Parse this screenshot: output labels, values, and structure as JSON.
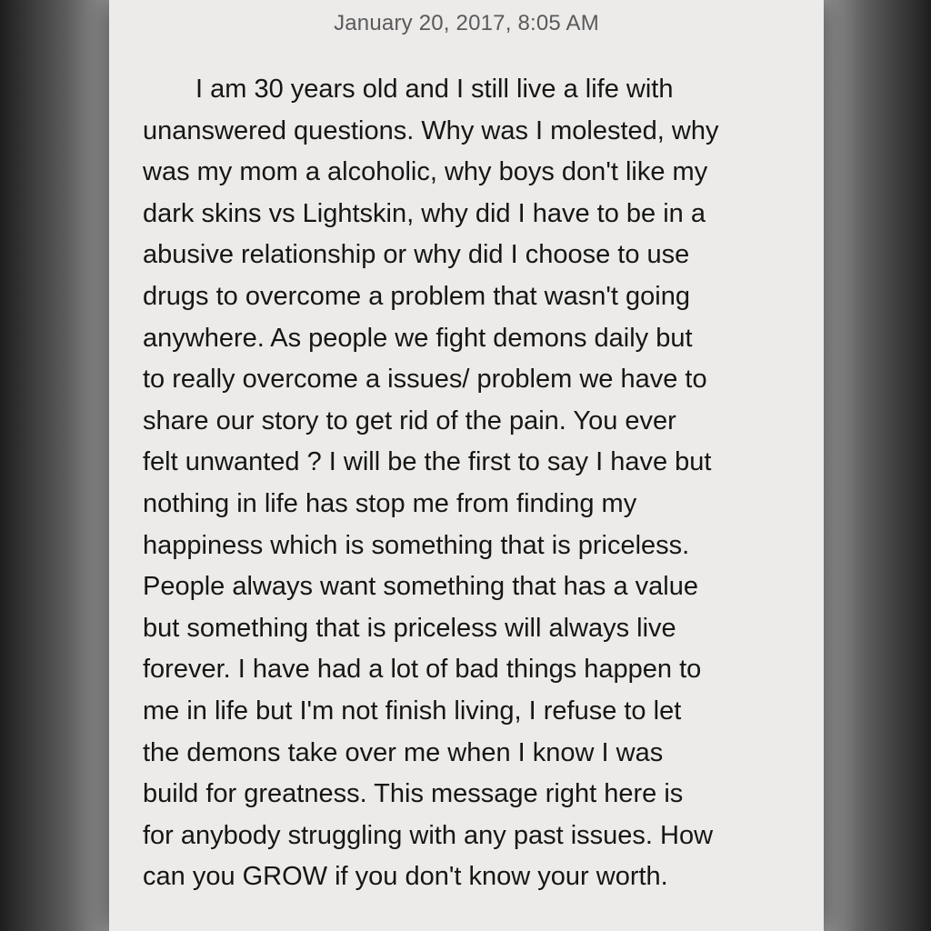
{
  "note": {
    "timestamp": "January 20, 2017, 8:05 AM",
    "body": "I am 30 years old and I still live a life with\nunanswered questions. Why was I molested, why\nwas my mom a alcoholic, why boys don't like my\ndark skins vs Lightskin, why did I have to be in a\nabusive relationship or why did I choose to use\ndrugs to overcome a problem that wasn't going\nanywhere. As people we fight demons daily but\nto really overcome a issues/ problem we have to\nshare our story to get rid of the pain. You ever\nfelt unwanted ? I will be the first to say I have but\nnothing in life has stop me from finding my\nhappiness which is something that is priceless.\nPeople always want something that has a value\nbut something that is priceless will always live\nforever. I have had a lot of bad things happen to\nme in life but I'm not finish living, I refuse to let\nthe demons take over me when I know I was\nbuild for greatness. This message right here is\nfor anybody struggling with any past issues. How\ncan you GROW if you don't know your worth."
  },
  "colors": {
    "paper": "#ecebe9",
    "text": "#161616",
    "timestamp": "#5a5a5c"
  }
}
